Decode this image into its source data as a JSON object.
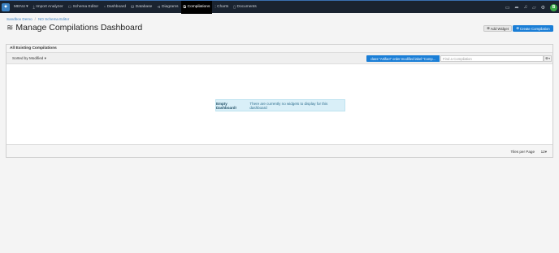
{
  "nav": {
    "menu": "MENU",
    "items": [
      {
        "label": "Import Analyzer",
        "icon": "download-icon",
        "glyph": "⤓"
      },
      {
        "label": "Schema Editor",
        "icon": "schema-icon",
        "glyph": "⚇"
      },
      {
        "label": "Dashboard",
        "icon": "dashboard-icon",
        "glyph": "◔"
      },
      {
        "label": "Database",
        "icon": "database-icon",
        "glyph": "⛁"
      },
      {
        "label": "Diagrams",
        "icon": "diagram-icon",
        "glyph": "⊲"
      },
      {
        "label": "Compilations",
        "icon": "compilations-icon",
        "glyph": "⧉"
      },
      {
        "label": "Charts",
        "icon": "chart-icon",
        "glyph": "⫶"
      },
      {
        "label": "Documents",
        "icon": "document-icon",
        "glyph": "▯"
      }
    ],
    "active_index": 5,
    "avatar": "B"
  },
  "breadcrumb": {
    "first": "Sandbox Demo",
    "separator": "/",
    "second": "NO Schema Editor"
  },
  "page": {
    "title": "Manage Compilations Dashboard"
  },
  "buttons": {
    "add_widget": "Add Widget",
    "create_compilation": "Create Compilation"
  },
  "panel": {
    "title": "All Existing Compilations",
    "sort_label": "Sorted by Modified",
    "query": "class:\"Artifact\" order:modified label:\"Comp...",
    "search_placeholder": "Find a Compilation",
    "empty_title": "Empty Dashboard!",
    "empty_text": "There are currently no widgets to display for this dashboard",
    "tiles_label": "Tiles per Page",
    "tiles_value": "12"
  },
  "colors": {
    "accent": "#1a7ed6",
    "topbar": "#1a2330",
    "avatar": "#39a845",
    "alert_bg": "#d9eff8"
  }
}
